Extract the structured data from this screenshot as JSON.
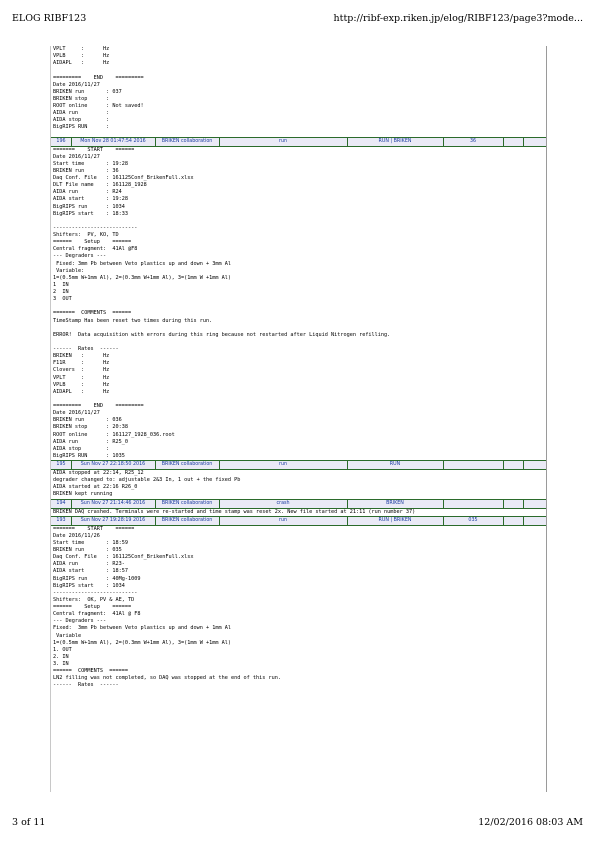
{
  "header": {
    "title": "ELOG RIBF123",
    "url": "http://ribf-exp.riken.jp/elog/RIBF123/page3?mode..."
  },
  "footer": {
    "page": "3 of 11",
    "datetime": "12/02/2016 08:03 AM"
  },
  "blocks": {
    "top_text": "VPLT     :      Hz\nVPLB     :      Hz\nAIDAPL   :      Hz\n\n=========    END    =========\nDate 2016/11/27\nBRIKEN run       : 037\nBRIKEN stop      :\nROOT online      : Not saved!\nAIDA run         :\nAIDA stop        :\nBigRIPS RUN      :",
    "entry_196": {
      "id": "196",
      "date": "Mon Nov 28 01:47:54 2016",
      "author": "BRIKEN collaboration",
      "type": "run",
      "category": "RUN | BRIKEN",
      "subject": "36",
      "text": "=======    START    ======\nDate 2016/11/27\nStart time       : 19:28\nBRIKEN run       : 36\nDaq Conf. File   : 161125Conf_BrikenFull.xlsx\nDLT File name    : 161128_1928\nAIDA run         : R24\nAIDA start       : 19:28\nBigRIPS run      : 1034\nBigRIPS start    : 18:33\n\n---------------------------\nShifters:  PV, KO, TD\n======    Setup    ======\nCentral fragment:  41Al @F8\n--- Degraders ---\n Fixed: 3mm Pb between Veto plastics up and down + 3mm Al\n Variable:\n1=(0.5mm W+1mm Al), 2=(0.3mm W+1mm Al), 3=(1mm W +1mm Al)\n1  IN\n2  IN\n3  OUT\n\n=======  COMMENTS  ======\nTimeStamp Has been reset two times during this run.\n\nERROR!  Data acquisition with errors during this ring because not restarted after Liquid Nitrogen refilling.\n\n------  Rates  ------\nBRIKEN   :      Hz\nF11R     :      Hz\nClovers  :      Hz\nVPLT     :      Hz\nVPLB     :      Hz\nAIDAPL   :      Hz\n\n=========    END    =========\nDate 2016/11/27\nBRIKEN run       : 036\nBRIKEN stop      : 20:38\nROOT online      : 161127_1928_036.root\nAIDA run         : R25_0\nAIDA stop        :\nBigRIPS RUN      : 1035\n"
    },
    "entry_195": {
      "id": "195",
      "date": "Sun Nov 27 22:18:50 2016",
      "author": "BRIKEN collaboration",
      "type": "run",
      "category": "RUN",
      "subject": "",
      "text": "AIDA stopped at 22:14, R25_12\ndegrader changed to: adjustable 2&3 In, 1 out + the fixed Pb\nAIDA started at 22:16 R26_0\nBRIKEN kept running\n"
    },
    "entry_194": {
      "id": "194",
      "date": "Sun Nov 27 21:14:46 2016",
      "author": "BRIKEN collaboration",
      "type": "crash",
      "category": "BRIKEN",
      "subject": "",
      "text": "BRIKEN DAQ crashed. Terminals were re-started and time stamp was reset 2x. New file started at 21:11 (run number 37)\n"
    },
    "entry_193": {
      "id": "193",
      "date": "Sun Nov 27 19:28:19 2016",
      "author": "BRIKEN collaboration",
      "type": "run",
      "category": "RUN | BRIKEN",
      "subject": "035",
      "text": "=======    START    ======\nDate 2016/11/26\nStart time       : 18:59\nBRIKEN run       : 035\nDaq Conf. File   : 161125Conf_BrikenFull.xlsx\nAIDA run         : R23-\nAIDA start       : 18:57\nBigRIPS run      : 40Mg-1009\nBigRIPS start    : 1034\n---------------------------\nShifters:  OK, PV & AE, TD\n======    Setup    ======\nCentral fragment:  41Al @ F8\n--- Degraders ---\nFixed:  3mm Pb between Veto plastics up and down + 1mm Al\n Variable\n1=(0.5mm W+1mm Al), 2=(0.3mm W+1mm Al), 3=(1mm W +1mm Al)\n1. OUT\n2. IN\n3. IN\n======  COMMENTS  ======\nLN2 filling was not completed, so DAQ was stopped at the end of this run.\n------  Rates  ------"
    }
  }
}
